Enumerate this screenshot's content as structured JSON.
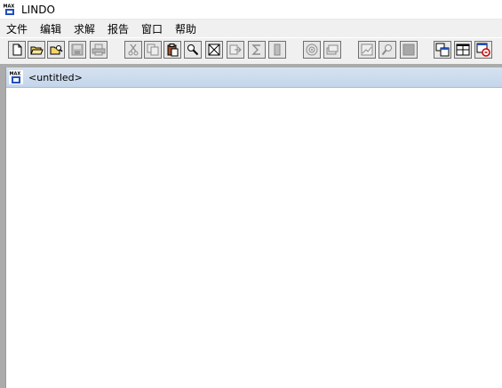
{
  "app": {
    "title": "LINDO",
    "icon": "max-lp-app-icon"
  },
  "menu": {
    "items": [
      {
        "label": "文件"
      },
      {
        "label": "编辑"
      },
      {
        "label": "求解"
      },
      {
        "label": "报告"
      },
      {
        "label": "窗口"
      },
      {
        "label": "帮助"
      }
    ]
  },
  "toolbar": {
    "buttons": [
      {
        "icon": "new-file-icon",
        "enabled": true
      },
      {
        "icon": "open-folder-icon",
        "enabled": true
      },
      {
        "icon": "view-open-icon",
        "enabled": true
      },
      {
        "icon": "save-disk-icon",
        "enabled": false
      },
      {
        "icon": "print-icon",
        "enabled": false
      },
      {
        "icon": "cut-scissors-icon",
        "enabled": false
      },
      {
        "icon": "copy-icon",
        "enabled": false
      },
      {
        "icon": "paste-clipboard-icon",
        "enabled": true
      },
      {
        "icon": "find-icon",
        "enabled": true
      },
      {
        "icon": "close-window-icon",
        "enabled": true
      },
      {
        "icon": "export-arrow-icon",
        "enabled": false
      },
      {
        "icon": "sigma-summary-icon",
        "enabled": false
      },
      {
        "icon": "blank-bar-icon",
        "enabled": false
      },
      {
        "icon": "solve-target-icon",
        "enabled": false
      },
      {
        "icon": "compile-stack-icon",
        "enabled": false
      },
      {
        "icon": "graph-chart-icon",
        "enabled": false
      },
      {
        "icon": "zoom-magnifier-icon",
        "enabled": false
      },
      {
        "icon": "gray-square-icon",
        "enabled": false
      },
      {
        "icon": "send-to-back-icon",
        "enabled": true
      },
      {
        "icon": "tile-windows-icon",
        "enabled": true
      },
      {
        "icon": "help-icon",
        "enabled": true
      }
    ]
  },
  "document": {
    "title": "<untitled>",
    "icon": "max-lp-doc-icon"
  },
  "colors": {
    "mdi_title": "#c9d9ed",
    "workspace": "#ababab",
    "menubar": "#f0f0f0",
    "accent_red": "#cc0000",
    "accent_blue": "#1f4fbf"
  }
}
